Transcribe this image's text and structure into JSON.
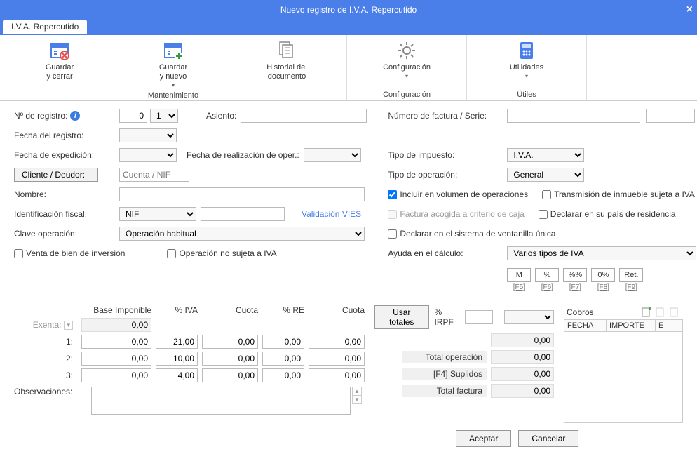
{
  "window": {
    "title": "Nuevo registro de I.V.A. Repercutido"
  },
  "tab": {
    "label": "I.V.A. Repercutido"
  },
  "ribbon": {
    "groups": {
      "mantenimiento": {
        "label": "Mantenimiento",
        "save_close": "Guardar\ny cerrar",
        "save_new": "Guardar\ny nuevo",
        "history": "Historial del\ndocumento"
      },
      "config": {
        "label": "Configuración",
        "btn": "Configuración"
      },
      "utils": {
        "label": "Útiles",
        "btn": "Utilidades"
      }
    }
  },
  "left": {
    "nreg": "Nº de registro:",
    "nreg_val": "0",
    "nreg_seq": "1",
    "asiento": "Asiento:",
    "fecha_reg": "Fecha del registro:",
    "fecha_exp": "Fecha de expedición:",
    "fecha_oper": "Fecha de realización de oper.:",
    "cliente_btn": "Cliente / Deudor:",
    "cliente_ph": "Cuenta / NIF",
    "nombre": "Nombre:",
    "idfiscal": "Identificación fiscal:",
    "idfiscal_sel": "NIF",
    "validacion": "Validación VIES",
    "clave": "Clave operación:",
    "clave_sel": "Operación habitual",
    "chk_venta": "Venta de bien de inversión",
    "chk_nosujeta": "Operación no sujeta a IVA"
  },
  "right": {
    "numfact": "Número de factura / Serie:",
    "tipoimp": "Tipo de impuesto:",
    "tipoimp_sel": "I.V.A.",
    "tipoop": "Tipo de operación:",
    "tipoop_sel": "General",
    "chk_incluir": "Incluir en volumen de operaciones",
    "chk_trans": "Transmisión de inmueble sujeta a IVA",
    "chk_criterio": "Factura acogida a criterio de caja",
    "chk_pais": "Declarar en su país de residencia",
    "chk_ventanilla": "Declarar en el sistema de ventanilla única",
    "ayuda": "Ayuda en el cálculo:",
    "ayuda_sel": "Varios tipos de IVA",
    "hb": {
      "m": "M",
      "pct": "%",
      "pctpct": "%%",
      "zero": "0%",
      "ret": "Ret."
    },
    "hk": {
      "f5": "[F5]",
      "f6": "[F6]",
      "f7": "[F7]",
      "f8": "[F8]",
      "f9": "[F9]"
    }
  },
  "grid": {
    "hdr": {
      "base": "Base Imponible",
      "iva": "% IVA",
      "cuota": "Cuota",
      "re": "% RE",
      "cuota2": "Cuota"
    },
    "usar": "Usar totales",
    "irpf": "% IRPF",
    "exenta": "Exenta:",
    "rows": [
      {
        "n": "1:",
        "base": "0,00",
        "iva": "21,00",
        "cuota": "0,00",
        "re": "0,00",
        "cuota2": "0,00"
      },
      {
        "n": "2:",
        "base": "0,00",
        "iva": "10,00",
        "cuota": "0,00",
        "re": "0,00",
        "cuota2": "0,00"
      },
      {
        "n": "3:",
        "base": "0,00",
        "iva": "4,00",
        "cuota": "0,00",
        "re": "0,00",
        "cuota2": "0,00"
      }
    ],
    "exenta_val": "0,00",
    "obs": "Observaciones:"
  },
  "totals": {
    "irpf_val": "0,00",
    "oper_lbl": "Total operación",
    "oper": "0,00",
    "sup_lbl": "[F4] Suplidos",
    "sup": "0,00",
    "fact_lbl": "Total factura",
    "fact": "0,00"
  },
  "cobros": {
    "title": "Cobros",
    "th1": "FECHA",
    "th2": "IMPORTE",
    "th3": "E"
  },
  "buttons": {
    "ok": "Aceptar",
    "cancel": "Cancelar"
  }
}
